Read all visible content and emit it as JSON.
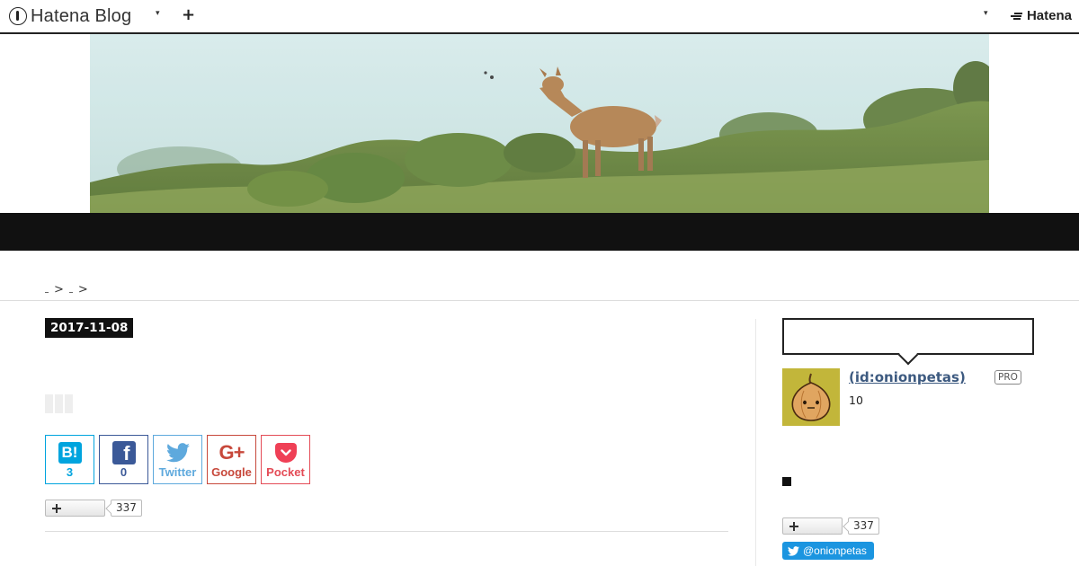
{
  "header": {
    "logo_text": "Hatena Blog",
    "plus_label": "+",
    "hatena_label": "Hatena"
  },
  "breadcrumb": {
    "sep1": ">",
    "sep2": ">"
  },
  "entry": {
    "date": "2017-11-08"
  },
  "share": {
    "hatena_icon": "B!",
    "hatena_count": "3",
    "facebook_icon": "f",
    "facebook_count": "0",
    "twitter_label": "Twitter",
    "google_icon": "G+",
    "google_label": "Google",
    "pocket_label": "Pocket"
  },
  "subscribe_main": {
    "count": "337"
  },
  "profile": {
    "name": "(id:onionpetas)",
    "badge": "PRO",
    "number": "10"
  },
  "subscribe_side": {
    "count": "337"
  },
  "twitter_follow": {
    "label": "@onionpetas"
  },
  "colors": {
    "hatena_bookmark": "#00A4DE",
    "facebook": "#3B5998",
    "twitter": "#5EA9DD",
    "google_plus": "#C7483B",
    "pocket": "#E44B56",
    "profile_link": "#3d5a80"
  },
  "icons": {
    "logo": "hatena-blog-logo-icon",
    "dropdown": "chevron-down-icon",
    "avatar": "onion-avatar-icon"
  }
}
